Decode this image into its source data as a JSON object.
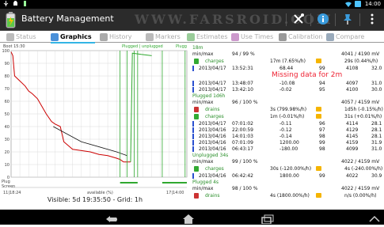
{
  "status_bar": {
    "time": "14:00",
    "left_icons": [
      "usb-icon",
      "android-icon",
      "battery-app-icon"
    ],
    "right_icons": [
      "wifi-icon",
      "battery-icon"
    ]
  },
  "app": {
    "title": "Battery Management",
    "watermark": "WWW.FARSROID.COM"
  },
  "action_icons": [
    "tools-icon",
    "info-icon",
    "pin-icon",
    "overflow-menu-icon"
  ],
  "tabs": [
    {
      "label": "Status",
      "active": false
    },
    {
      "label": "Graphics",
      "active": true
    },
    {
      "label": "History",
      "active": false
    },
    {
      "label": "Markers",
      "active": false
    },
    {
      "label": "Estimates",
      "active": false
    },
    {
      "label": "Use Times",
      "active": false
    },
    {
      "label": "Calibration",
      "active": false
    },
    {
      "label": "Compare",
      "active": false
    }
  ],
  "chart": {
    "top_left": "Boot 15:30",
    "top_mid": "Plugged | unplugged",
    "top_right": "Plugg",
    "y_ticks": [
      "100",
      "90",
      "80",
      "70",
      "60",
      "50",
      "40",
      "30",
      "20",
      "10",
      "0"
    ],
    "bottom_left_label": "Plug",
    "bottom_left_label2": "Screen",
    "x_left": "11|18:24",
    "x_mid": "available (%)",
    "x_right": "17|14:00",
    "footer": "Visible: 5d 19:35:50 - Grid: 1h",
    "colors": {
      "drain": "#cc0000",
      "charge": "#2fa82f",
      "trend": "#111111",
      "grid": "#d8d8d8"
    }
  },
  "chart_data": {
    "type": "line",
    "x_unit": "time (5d 19:35:50 span)",
    "ylim": [
      0,
      100
    ],
    "series": [
      {
        "values_xfrac": [
          0.0,
          0.01,
          0.02,
          0.05,
          0.08,
          0.1,
          0.12,
          0.15,
          0.2,
          0.23,
          0.25,
          0.28,
          0.3,
          0.35,
          0.4,
          0.45,
          0.5,
          0.55,
          0.6,
          0.62,
          0.63,
          0.64,
          0.66,
          0.68,
          0.69,
          0.74,
          0.8
        ],
        "values": [
          99,
          96,
          80,
          76,
          72,
          68,
          66,
          62,
          50,
          44,
          42,
          40,
          28,
          22,
          21,
          20,
          18,
          17,
          15,
          14,
          13,
          12,
          12,
          12,
          98,
          97,
          96
        ]
      }
    ]
  },
  "list": {
    "header": {
      "left": "18m",
      "right": ""
    },
    "sections": [
      {
        "title": "",
        "minmax_label": "min/max",
        "minmax_value": "94 / 99 %",
        "minmax_right": "4041 / 4190 mV",
        "rows": [
          {
            "type": "charges",
            "rate_left": "17m (7.65%/h)",
            "rate_right": "29s (0.44%/h)"
          },
          {
            "date": "2013/04/17",
            "time": "13:52:31",
            "v1": "68.44",
            "v2": "99",
            "v3": "4108",
            "v4": "32.0"
          },
          {
            "missing": "Missing data for 2m"
          },
          {
            "date": "2013/04/17",
            "time": "13:48:07",
            "v1": "-10.08",
            "v2": "94",
            "v3": "4097",
            "v4": "31.0"
          },
          {
            "date": "2013/04/17",
            "time": "13:42:10",
            "v1": "-0.02",
            "v2": "95",
            "v3": "4100",
            "v4": "30.0"
          }
        ]
      },
      {
        "title": "Plugged 1d6h",
        "minmax_label": "min/max",
        "minmax_value": "96 / 100 %",
        "minmax_right": "4057 / 4159 mV",
        "rows": [
          {
            "type": "drains",
            "rate_left": "3s (799.98%/h)",
            "rate_right": "1d5h (-0.15%/h)"
          },
          {
            "type": "charges",
            "rate_left": "1m (-0.01%/h)",
            "rate_right": "31s (+0.01%/h)"
          },
          {
            "date": "2013/04/17",
            "time": "07:01:02",
            "v1": "-0.11",
            "v2": "96",
            "v3": "4114",
            "v4": "28.1"
          },
          {
            "date": "2013/04/16",
            "time": "22:00:59",
            "v1": "-0.12",
            "v2": "97",
            "v3": "4129",
            "v4": "28.1"
          },
          {
            "date": "2013/04/16",
            "time": "14:01:03",
            "v1": "-0.14",
            "v2": "98",
            "v3": "4145",
            "v4": "28.1"
          },
          {
            "date": "2013/04/16",
            "time": "07:01:09",
            "v1": "1200.00",
            "v2": "99",
            "v3": "4159",
            "v4": "31.9"
          },
          {
            "date": "2013/04/16",
            "time": "06:43:17",
            "v1": "-180.00",
            "v2": "98",
            "v3": "4099",
            "v4": "31.0"
          }
        ]
      },
      {
        "title": "Unplugged 34s",
        "minmax_label": "min/max",
        "minmax_value": "99 / 100 %",
        "minmax_right": "4022 / 4159 mV",
        "rows": [
          {
            "type": "charges",
            "rate_left": "30s (-120.00%/h)",
            "rate_right": "4s (-240.00%/h)"
          },
          {
            "date": "2013/04/16",
            "time": "06:42:42",
            "v1": "1800.00",
            "v2": "99",
            "v3": "4022",
            "v4": "30.9"
          }
        ]
      },
      {
        "title": "Plugged 4s",
        "minmax_label": "min/max",
        "minmax_value": "98 / 100 %",
        "minmax_right": "4022 / 4159 mV",
        "rows": [
          {
            "type": "drains",
            "rate_left": "4s (1800.00%/h)",
            "rate_right": "n/s (0.00%/h)"
          }
        ]
      }
    ]
  },
  "nav_icons": [
    "back-icon",
    "home-icon",
    "recent-apps-icon",
    "up-arrow-icon"
  ]
}
